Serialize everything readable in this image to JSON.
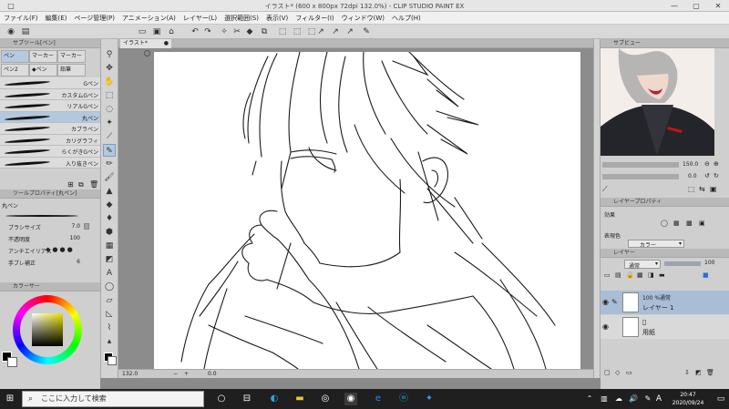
{
  "title": "イラスト* (600 x 800px 72dpi 132.0%) - CLIP STUDIO PAINT EX",
  "menu": [
    "ファイル(F)",
    "編集(E)",
    "ページ管理(P)",
    "アニメーション(A)",
    "レイヤー(L)",
    "選択範囲(S)",
    "表示(V)",
    "フィルター(I)",
    "ウィンドウ(W)",
    "ヘルプ(H)"
  ],
  "subtool": {
    "header": "サブツール[ペン]",
    "tabs": [
      "ペン",
      "マーカー",
      "ペン2",
      "◆ペン",
      "鉛筆",
      "横流り"
    ],
    "brushes": [
      "Gペン",
      "カスタムGペン",
      "リアルGペン",
      "丸ペン",
      "カブラペン",
      "カリグラフィ",
      "らくがきGペン",
      "入り抜きペン"
    ],
    "active_index": 3
  },
  "tool_property": {
    "header": "ツールプロパティ[丸ペン]",
    "name": "丸ペン",
    "size_label": "ブラシサイズ",
    "size_value": "7.0",
    "opacity_label": "不透明度",
    "opacity_value": "100",
    "antialias_label": "アンチエイリアス",
    "stabilize_label": "手ブレ補正",
    "stabilize_value": "6"
  },
  "color_panel": {
    "header": "カラーサー",
    "main_color": "#000000",
    "sub_color": "#ffffff",
    "field_color": "#8a8a22"
  },
  "document": {
    "tab": "イラスト*",
    "zoom": "132.0",
    "angle": "0.0"
  },
  "navigator": {
    "header": "サブビュー",
    "zoom": "150.0",
    "angle": "0.0"
  },
  "layer_property": {
    "header": "レイヤープロパティ",
    "effect_label": "効果",
    "express_label": "表現色",
    "express_value": "カラー"
  },
  "layers_panel": {
    "header": "レイヤー",
    "blend": "通常",
    "opacity": "100",
    "layers": [
      {
        "top": "100 %通常",
        "name": "レイヤー 1"
      },
      {
        "top": "",
        "name": "用紙"
      }
    ]
  },
  "taskbar": {
    "search": "ここに入力して検索",
    "time": "20:47",
    "date": "2020/09/24",
    "ime": "A"
  }
}
